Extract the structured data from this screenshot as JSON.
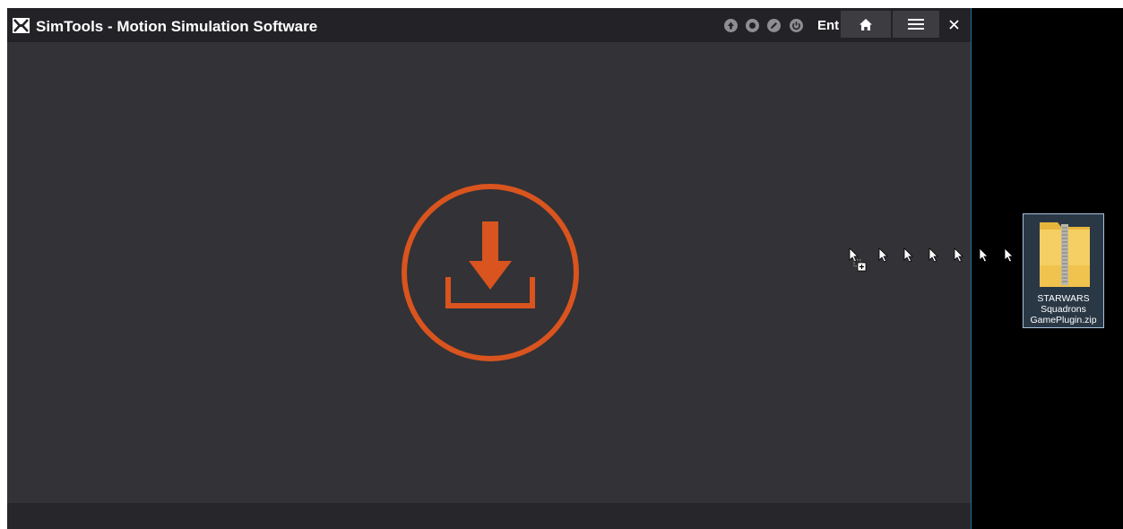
{
  "window": {
    "title": "SimTools - Motion Simulation Software",
    "mode_label": "Ent",
    "buttons": [
      "home",
      "menu",
      "close"
    ],
    "status_indicators": [
      "arrow-up-icon",
      "stop-icon",
      "pencil-icon",
      "power-icon"
    ]
  },
  "content": {
    "drop_icon": "download-icon",
    "accent_color": "#d9541e"
  },
  "desktop": {
    "file": {
      "name_lines": [
        "STARWARS",
        "Squadrons",
        "GamePlugin.zip"
      ],
      "icon": "zip-folder-icon"
    },
    "cursor_count": 7
  }
}
